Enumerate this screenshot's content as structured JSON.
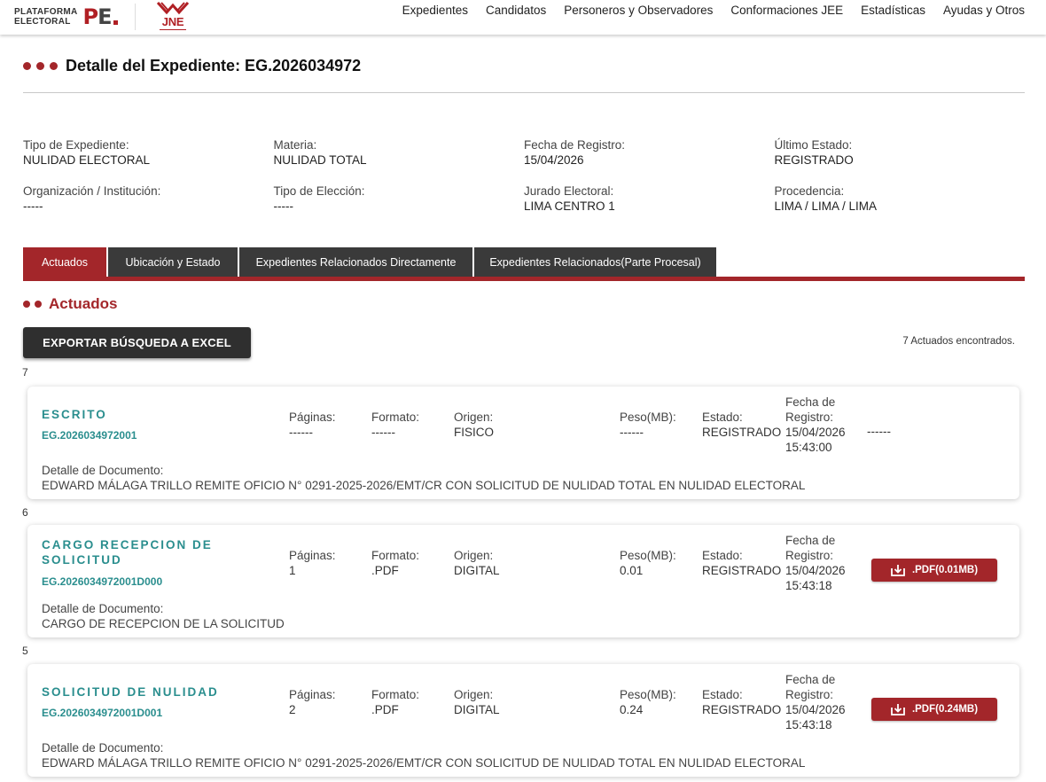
{
  "header": {
    "logo_pe_line1": "PLATAFORMA",
    "logo_pe_line2": "ELECTORAL",
    "logo_pe_mark": "PE",
    "logo_jne": "JNE",
    "nav": [
      "Expedientes",
      "Candidatos",
      "Personeros y Observadores",
      "Conformaciones JEE",
      "Estadísticas",
      "Ayudas y Otros"
    ]
  },
  "page": {
    "title": "Detalle del Expediente: EG.2026034972"
  },
  "info": {
    "tipo_expediente": {
      "label": "Tipo de Expediente:",
      "value": "NULIDAD ELECTORAL"
    },
    "materia": {
      "label": "Materia:",
      "value": "NULIDAD TOTAL"
    },
    "fecha_registro": {
      "label": "Fecha de Registro:",
      "value": "15/04/2026"
    },
    "ultimo_estado": {
      "label": "Último Estado:",
      "value": "REGISTRADO"
    },
    "organizacion": {
      "label": "Organización / Institución:",
      "value": "-----"
    },
    "tipo_eleccion": {
      "label": "Tipo de Elección:",
      "value": "-----"
    },
    "jurado": {
      "label": "Jurado Electoral:",
      "value": "LIMA CENTRO 1"
    },
    "procedencia": {
      "label": "Procedencia:",
      "value": "LIMA / LIMA / LIMA"
    }
  },
  "tabs": [
    "Actuados",
    "Ubicación y Estado",
    "Expedientes Relacionados Directamente",
    "Expedientes Relacionados(Parte Procesal)"
  ],
  "active_tab": "Actuados",
  "section": {
    "title": "Actuados",
    "export_label": "EXPORTAR BÚSQUEDA A EXCEL",
    "found_text": "7 Actuados encontrados."
  },
  "labels": {
    "paginas": "Páginas:",
    "formato": "Formato:",
    "origen": "Origen:",
    "peso": "Peso(MB):",
    "estado": "Estado:",
    "fecha_line1": "Fecha de",
    "fecha_line2": "Registro:",
    "detalle": "Detalle de Documento:"
  },
  "records": [
    {
      "num": "7",
      "doc_type": "ESCRITO",
      "code": "EG.2026034972001",
      "paginas": "------",
      "formato": "------",
      "origen": "FISICO",
      "peso": "------",
      "estado": "REGISTRADO",
      "fecha": "15/04/2026",
      "hora": "15:43:00",
      "file": "------",
      "detalle": "EDWARD MÁLAGA TRILLO REMITE OFICIO N° 0291-2025-2026/EMT/CR CON SOLICITUD DE NULIDAD TOTAL EN NULIDAD ELECTORAL"
    },
    {
      "num": "6",
      "doc_type": "CARGO RECEPCION DE SOLICITUD",
      "code": "EG.2026034972001D000",
      "paginas": "1",
      "formato": ".PDF",
      "origen": "DIGITAL",
      "peso": "0.01",
      "estado": "REGISTRADO",
      "fecha": "15/04/2026",
      "hora": "15:43:18",
      "file": ".PDF(0.01MB)",
      "detalle": "CARGO DE RECEPCION DE LA SOLICITUD"
    },
    {
      "num": "5",
      "doc_type": "SOLICITUD DE NULIDAD",
      "code": "EG.2026034972001D001",
      "paginas": "2",
      "formato": ".PDF",
      "origen": "DIGITAL",
      "peso": "0.24",
      "estado": "REGISTRADO",
      "fecha": "15/04/2026",
      "hora": "15:43:18",
      "file": ".PDF(0.24MB)",
      "detalle": "EDWARD MÁLAGA TRILLO REMITE OFICIO N° 0291-2025-2026/EMT/CR CON SOLICITUD DE NULIDAD TOTAL EN NULIDAD ELECTORAL"
    }
  ]
}
